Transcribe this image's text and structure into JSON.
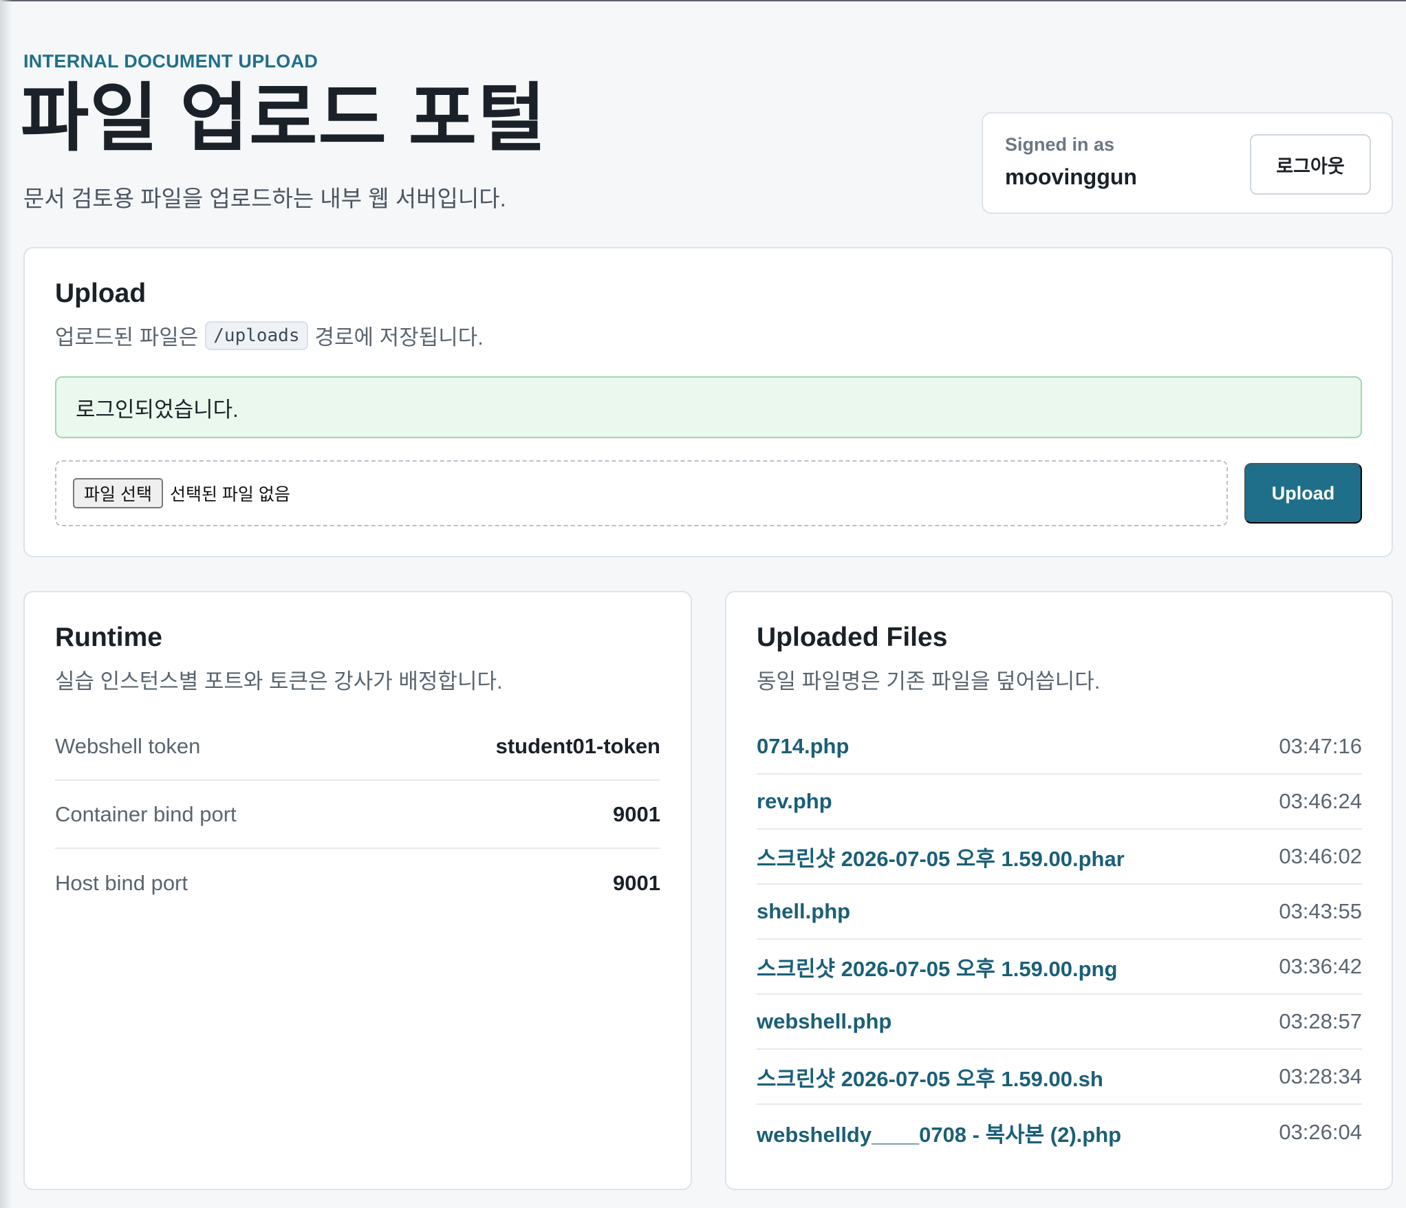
{
  "header": {
    "eyebrow": "INTERNAL DOCUMENT UPLOAD",
    "title": "파일 업로드 포털",
    "subtitle": "문서 검토용 파일을 업로드하는 내부 웹 서버입니다."
  },
  "user": {
    "label": "Signed in as",
    "name": "moovinggun",
    "logout_label": "로그아웃"
  },
  "upload": {
    "title": "Upload",
    "desc_before": "업로드된 파일은",
    "path": "/uploads",
    "desc_after": "경로에 저장됩니다.",
    "alert": "로그인되었습니다.",
    "file_button": "파일 선택",
    "file_status": "선택된 파일 없음",
    "submit_label": "Upload"
  },
  "runtime": {
    "title": "Runtime",
    "desc": "실습 인스턴스별 포트와 토큰은 강사가 배정합니다.",
    "rows": [
      {
        "key": "Webshell token",
        "value": "student01-token"
      },
      {
        "key": "Container bind port",
        "value": "9001"
      },
      {
        "key": "Host bind port",
        "value": "9001"
      }
    ]
  },
  "files": {
    "title": "Uploaded Files",
    "desc": "동일 파일명은 기존 파일을 덮어씁니다.",
    "items": [
      {
        "name": "0714.php",
        "time": "03:47:16"
      },
      {
        "name": "rev.php",
        "time": "03:46:24"
      },
      {
        "name": "스크린샷 2026-07-05 오후 1.59.00.phar",
        "time": "03:46:02"
      },
      {
        "name": "shell.php",
        "time": "03:43:55"
      },
      {
        "name": "스크린샷 2026-07-05 오후 1.59.00.png",
        "time": "03:36:42"
      },
      {
        "name": "webshell.php",
        "time": "03:28:57"
      },
      {
        "name": "스크린샷 2026-07-05 오후 1.59.00.sh",
        "time": "03:28:34"
      },
      {
        "name": "webshelldy____0708 - 복사본 (2).php",
        "time": "03:26:04"
      }
    ]
  }
}
